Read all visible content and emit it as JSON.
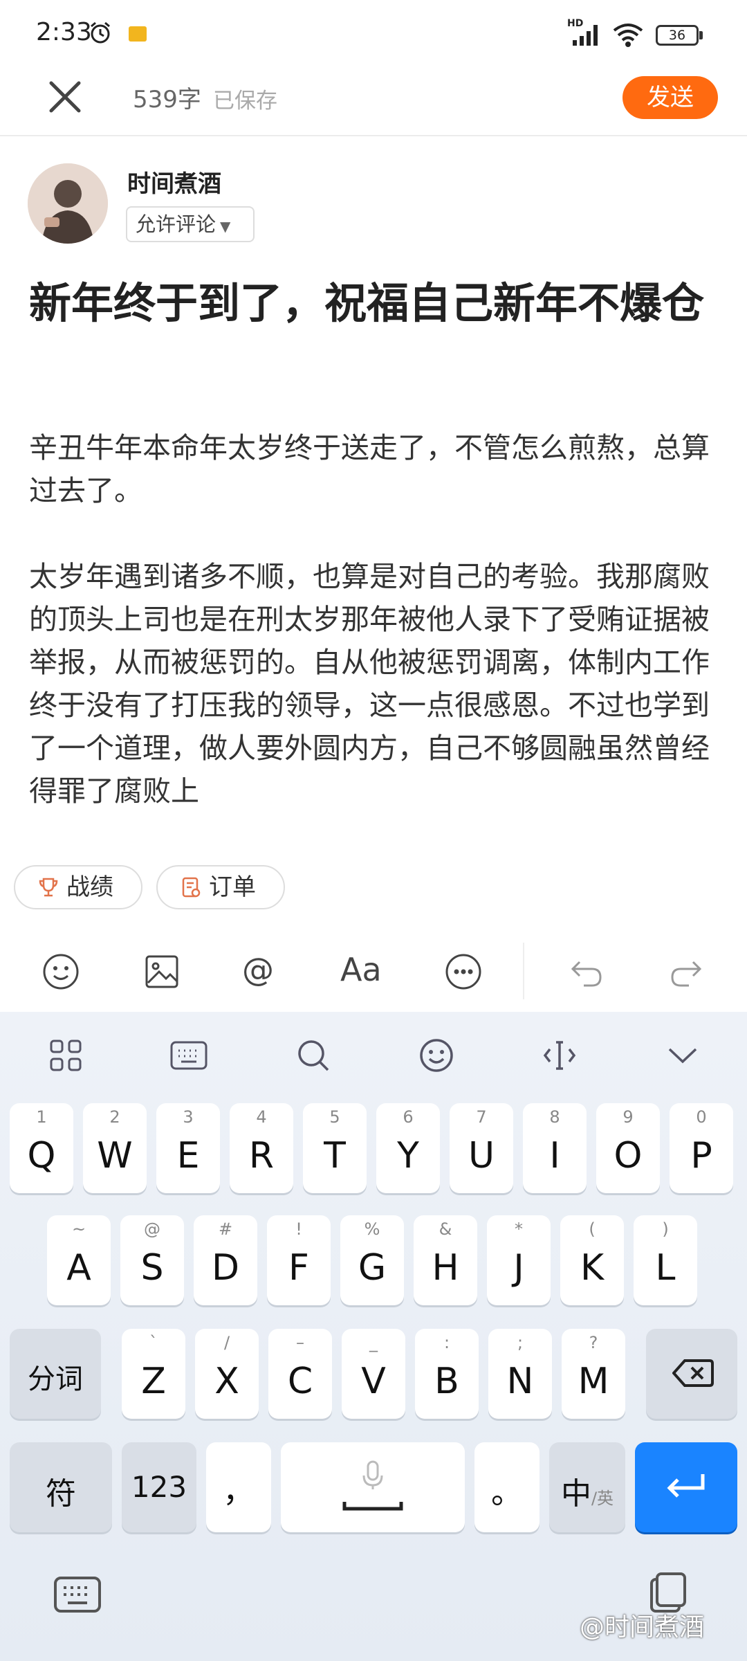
{
  "status_bar": {
    "time": "2:33",
    "network": "HD",
    "battery": "36"
  },
  "header": {
    "word_count": "539字",
    "saved": "已保存",
    "send_label": "发送"
  },
  "author": {
    "name": "时间煮酒",
    "comment_setting": "允许评论"
  },
  "article": {
    "title": "新年终于到了，祝福自己新年不爆仓",
    "paragraphs": [
      "辛丑牛年本命年太岁终于送走了，不管怎么煎熬，总算过去了。",
      "太岁年遇到诸多不顺，也算是对自己的考验。我那腐败的顶头上司也是在刑太岁那年被他人录下了受贿证据被举报，从而被惩罚的。自从他被惩罚调离，体制内工作终于没有了打压我的领导，这一点很感恩。不过也学到了一个道理，做人要外圆内方，自己不够圆融虽然曾经得罪了腐败上"
    ]
  },
  "chips": {
    "score": "战绩",
    "order": "订单"
  },
  "toolbar": {
    "icons": [
      "emoji-icon",
      "image-icon",
      "mention-icon",
      "text-format-icon",
      "more-icon",
      "undo-icon",
      "redo-icon"
    ],
    "mention_label": "@",
    "format_label": "Aa"
  },
  "keyboard": {
    "row1": [
      {
        "num": "1",
        "key": "Q"
      },
      {
        "num": "2",
        "key": "W"
      },
      {
        "num": "3",
        "key": "E"
      },
      {
        "num": "4",
        "key": "R"
      },
      {
        "num": "5",
        "key": "T"
      },
      {
        "num": "6",
        "key": "Y"
      },
      {
        "num": "7",
        "key": "U"
      },
      {
        "num": "8",
        "key": "I"
      },
      {
        "num": "9",
        "key": "O"
      },
      {
        "num": "0",
        "key": "P"
      }
    ],
    "row2": [
      {
        "sym": "~",
        "key": "A"
      },
      {
        "sym": "@",
        "key": "S"
      },
      {
        "sym": "#",
        "key": "D"
      },
      {
        "sym": "!",
        "key": "F"
      },
      {
        "sym": "%",
        "key": "G"
      },
      {
        "sym": "&",
        "key": "H"
      },
      {
        "sym": "*",
        "key": "J"
      },
      {
        "sym": "(",
        "key": "K"
      },
      {
        "sym": ")",
        "key": "L"
      }
    ],
    "row3": [
      {
        "sym": "`",
        "key": "Z"
      },
      {
        "sym": "/",
        "key": "X"
      },
      {
        "sym": "–",
        "key": "C"
      },
      {
        "sym": "_",
        "key": "V"
      },
      {
        "sym": ":",
        "key": "B"
      },
      {
        "sym": ";",
        "key": "N"
      },
      {
        "sym": "?",
        "key": "M"
      }
    ],
    "segment_label": "分词",
    "symbol_label": "符",
    "num_label": "123",
    "comma": "，",
    "period": "。",
    "lang_main": "中",
    "lang_alt": "/英"
  },
  "watermark": "@时间煮酒",
  "colors": {
    "accent": "#ff6a10",
    "enter": "#1a84ff"
  }
}
